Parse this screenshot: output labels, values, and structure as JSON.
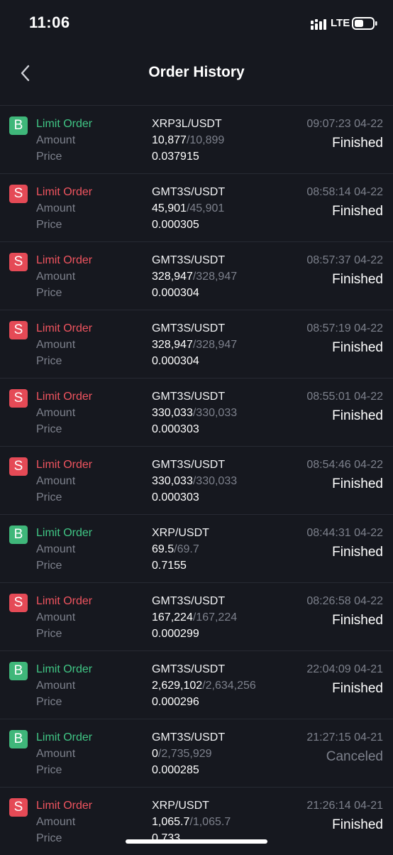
{
  "status_bar": {
    "time": "11:06",
    "network": "LTE"
  },
  "header": {
    "title": "Order History",
    "back_icon": "chevron-left-icon"
  },
  "colors": {
    "background": "#16181f",
    "buy": "#40c685",
    "sell": "#f0545f",
    "muted": "#7d818c"
  },
  "labels": {
    "amount": "Amount",
    "price": "Price"
  },
  "orders": [
    {
      "side": "buy",
      "badge": "B",
      "type": "Limit Order",
      "pair": "XRP3L/USDT",
      "filled": "10,877",
      "total": "/10,899",
      "price": "0.037915",
      "time": "09:07:23 04-22",
      "status": "Finished"
    },
    {
      "side": "sell",
      "badge": "S",
      "type": "Limit Order",
      "pair": "GMT3S/USDT",
      "filled": "45,901",
      "total": "/45,901",
      "price": "0.000305",
      "time": "08:58:14 04-22",
      "status": "Finished"
    },
    {
      "side": "sell",
      "badge": "S",
      "type": "Limit Order",
      "pair": "GMT3S/USDT",
      "filled": "328,947",
      "total": "/328,947",
      "price": "0.000304",
      "time": "08:57:37 04-22",
      "status": "Finished"
    },
    {
      "side": "sell",
      "badge": "S",
      "type": "Limit Order",
      "pair": "GMT3S/USDT",
      "filled": "328,947",
      "total": "/328,947",
      "price": "0.000304",
      "time": "08:57:19 04-22",
      "status": "Finished"
    },
    {
      "side": "sell",
      "badge": "S",
      "type": "Limit Order",
      "pair": "GMT3S/USDT",
      "filled": "330,033",
      "total": "/330,033",
      "price": "0.000303",
      "time": "08:55:01 04-22",
      "status": "Finished"
    },
    {
      "side": "sell",
      "badge": "S",
      "type": "Limit Order",
      "pair": "GMT3S/USDT",
      "filled": "330,033",
      "total": "/330,033",
      "price": "0.000303",
      "time": "08:54:46 04-22",
      "status": "Finished"
    },
    {
      "side": "buy",
      "badge": "B",
      "type": "Limit Order",
      "pair": "XRP/USDT",
      "filled": "69.5",
      "total": "/69.7",
      "price": "0.7155",
      "time": "08:44:31 04-22",
      "status": "Finished"
    },
    {
      "side": "sell",
      "badge": "S",
      "type": "Limit Order",
      "pair": "GMT3S/USDT",
      "filled": "167,224",
      "total": "/167,224",
      "price": "0.000299",
      "time": "08:26:58 04-22",
      "status": "Finished"
    },
    {
      "side": "buy",
      "badge": "B",
      "type": "Limit Order",
      "pair": "GMT3S/USDT",
      "filled": "2,629,102",
      "total": "/2,634,256",
      "price": "0.000296",
      "time": "22:04:09 04-21",
      "status": "Finished"
    },
    {
      "side": "buy",
      "badge": "B",
      "type": "Limit Order",
      "pair": "GMT3S/USDT",
      "filled": "0",
      "total": "/2,735,929",
      "price": "0.000285",
      "time": "21:27:15 04-21",
      "status": "Canceled"
    },
    {
      "side": "sell",
      "badge": "S",
      "type": "Limit Order",
      "pair": "XRP/USDT",
      "filled": "1,065.7",
      "total": "/1,065.7",
      "price": "0.733",
      "time": "21:26:14 04-21",
      "status": "Finished"
    }
  ]
}
